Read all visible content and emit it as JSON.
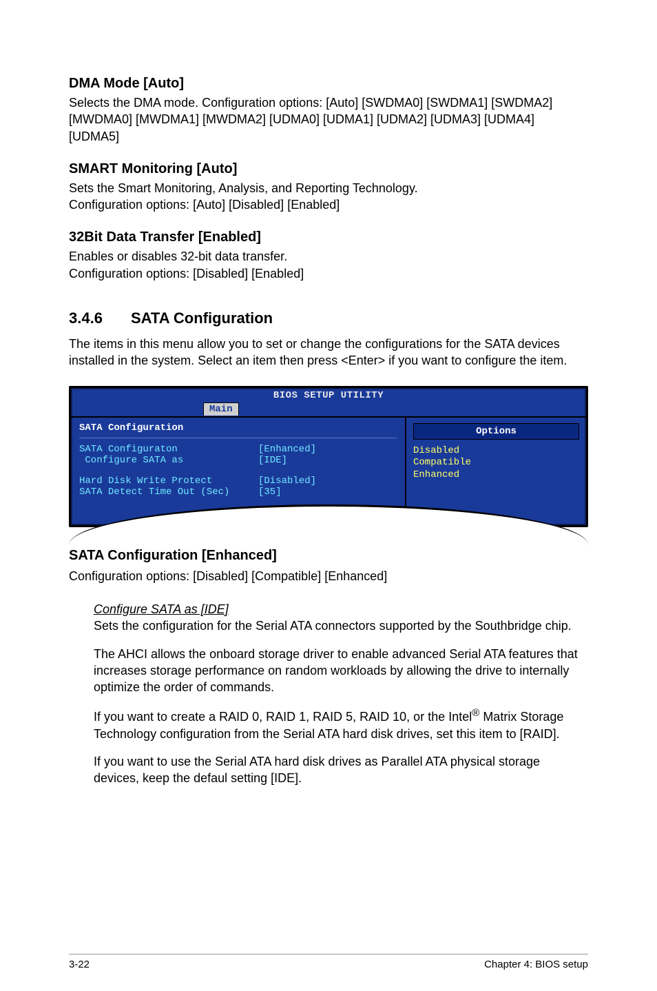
{
  "s1": {
    "title": "DMA Mode [Auto]",
    "body": "Selects the DMA mode. Configuration options: [Auto] [SWDMA0] [SWDMA1] [SWDMA2] [MWDMA0] [MWDMA1] [MWDMA2] [UDMA0] [UDMA1] [UDMA2] [UDMA3] [UDMA4] [UDMA5]"
  },
  "s2": {
    "title": "SMART Monitoring [Auto]",
    "body1": "Sets the Smart Monitoring, Analysis, and Reporting Technology.",
    "body2": "Configuration options: [Auto] [Disabled] [Enabled]"
  },
  "s3": {
    "title": "32Bit Data Transfer [Enabled]",
    "body1": "Enables or disables 32-bit data transfer.",
    "body2": "Configuration options: [Disabled] [Enabled]"
  },
  "section": {
    "number": "3.4.6",
    "title": "SATA Configuration",
    "intro": "The items in this menu allow you to set or change the configurations for the SATA devices installed in the system. Select an item then press <Enter> if you want to configure the item."
  },
  "bios": {
    "title": "BIOS SETUP UTILITY",
    "tab": "Main",
    "left_header": "SATA Configuration",
    "rows": [
      {
        "label": "SATA Configuraton",
        "value": "[Enhanced]"
      },
      {
        "label": " Configure SATA as",
        "value": "[IDE]"
      },
      {
        "label": "",
        "value": ""
      },
      {
        "label": "Hard Disk Write Protect",
        "value": "[Disabled]"
      },
      {
        "label": "SATA Detect Time Out (Sec)",
        "value": "[35]"
      }
    ],
    "options_title": "Options",
    "options": [
      "Disabled",
      "Compatible",
      "Enhanced"
    ]
  },
  "s4": {
    "title": "SATA Configuration [Enhanced]",
    "body": "Configuration options: [Disabled] [Compatible] [Enhanced]"
  },
  "indent": {
    "heading": "Configure SATA as [IDE]",
    "p1": "Sets the configuration for the Serial ATA connectors supported by the Southbridge chip.",
    "p2": "The AHCI allows the onboard storage driver to enable advanced Serial ATA features that increases storage performance on random workloads by allowing the drive to internally optimize the order of commands.",
    "p3a": "If you want to create a RAID 0, RAID 1,  RAID 5,  RAID 10, or the Intel",
    "p3sup": "®",
    "p3b": " Matrix Storage Technology configuration from the Serial ATA hard disk drives, set this item to [RAID].",
    "p4": "If you want to use the Serial ATA hard disk drives as Parallel ATA physical storage devices, keep the defaul setting [IDE]."
  },
  "footer": {
    "left": "3-22",
    "right": "Chapter 4: BIOS setup"
  }
}
